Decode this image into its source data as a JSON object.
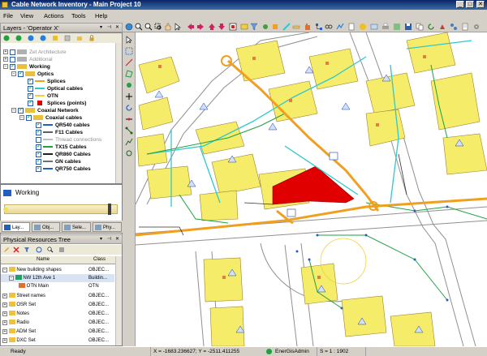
{
  "window": {
    "title": "Cable Network Inventory - Main Project 10",
    "minimize": "_",
    "maximize": "□",
    "close": "✕"
  },
  "menu": [
    "File",
    "View",
    "Actions",
    "Tools",
    "Help"
  ],
  "layers_panel": {
    "title": "Layers - 'Operator X'",
    "items": [
      {
        "label": "Zet Architecture",
        "style": "grey"
      },
      {
        "label": "Additional",
        "style": "grey"
      },
      {
        "label": "Working",
        "style": "bold"
      },
      {
        "label": "Optics",
        "style": "bold"
      },
      {
        "label": "Splices",
        "color": "#f0a020"
      },
      {
        "label": "Optical cables",
        "color": "#30c8d0"
      },
      {
        "label": "OTN",
        "color": "#f0d040"
      },
      {
        "label": "Splices (points)",
        "color": "#e00000"
      },
      {
        "label": "Coaxial Network",
        "style": "bold"
      },
      {
        "label": "Coaxial cables",
        "style": "bold"
      },
      {
        "label": "QR540 cables",
        "color": "#2060c0"
      },
      {
        "label": "F11 Cables",
        "color": "#606060"
      },
      {
        "label": "Thread connections",
        "style": "grey"
      },
      {
        "label": "TX15 Cables",
        "color": "#20a040"
      },
      {
        "label": "QR860 Cables",
        "color": "#202020"
      },
      {
        "label": "GN cables",
        "color": "#707070"
      },
      {
        "label": "QR750 Cables",
        "color": "#2060c0"
      }
    ]
  },
  "working_panel": {
    "label": "Working"
  },
  "tabs": [
    "Lay...",
    "Obj...",
    "Sele...",
    "Phy..."
  ],
  "physical_panel": {
    "title": "Physical Resources Tree",
    "col_name": "Name",
    "col_class": "Class",
    "rows": [
      {
        "name": "New building shapes",
        "cls": "OBJEC..."
      },
      {
        "name": "NW 12th Ave 1",
        "cls": "Buildin..."
      },
      {
        "name": "OTN Main",
        "cls": "OTN"
      },
      {
        "name": "Street names",
        "cls": "OBJEC..."
      },
      {
        "name": "OSR Set",
        "cls": "OBJEC..."
      },
      {
        "name": "Notes",
        "cls": "OBJEC..."
      },
      {
        "name": "Radio",
        "cls": "OBJEC..."
      },
      {
        "name": "ADM Set",
        "cls": "OBJEC..."
      },
      {
        "name": "DXC Set",
        "cls": "OBJEC..."
      }
    ]
  },
  "status": {
    "ready": "Ready",
    "coords": "X = -1683.236627; Y = -2511.411255",
    "user": "EnerGisAdmin",
    "scale": "S = 1 : 1902"
  },
  "colors": {
    "building": "#f5ec6a",
    "cable_orange": "#f0a020",
    "cable_cyan": "#30c8d0",
    "cable_green": "#20a040",
    "highlight": "#e00000"
  }
}
